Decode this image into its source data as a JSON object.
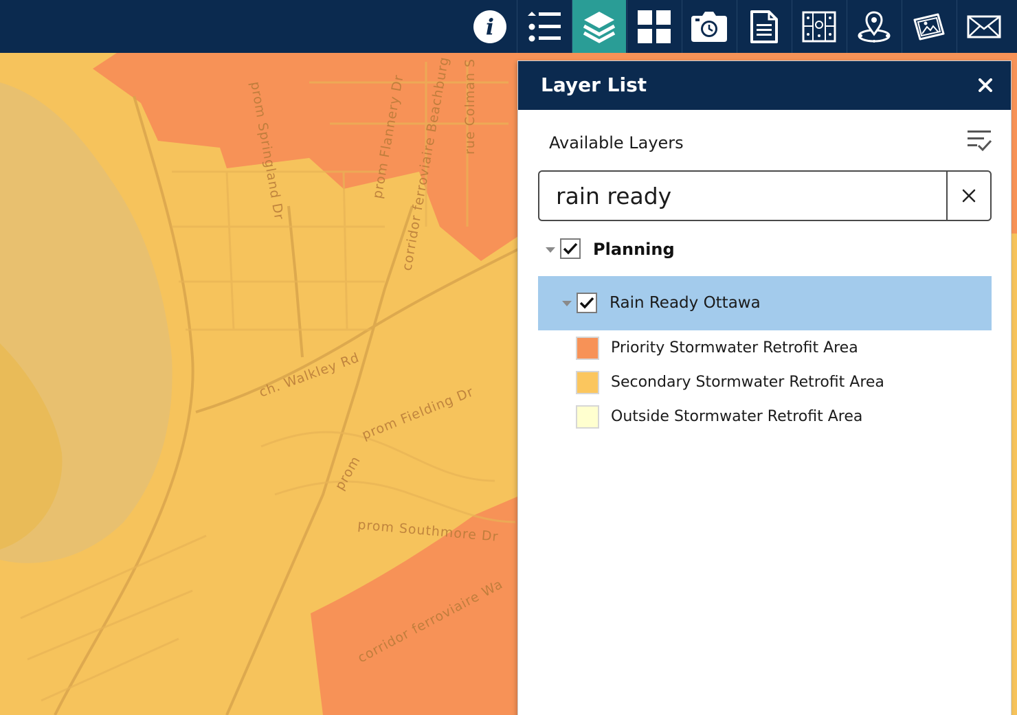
{
  "toolbar": {
    "buttons": [
      {
        "name": "info-icon",
        "active": false
      },
      {
        "name": "legend-list-icon",
        "active": false
      },
      {
        "name": "layers-icon",
        "active": true
      },
      {
        "name": "basemap-grid-icon",
        "active": false
      },
      {
        "name": "timed-camera-icon",
        "active": false
      },
      {
        "name": "document-icon",
        "active": false
      },
      {
        "name": "floor-plan-icon",
        "active": false
      },
      {
        "name": "location-pin-icon",
        "active": false
      },
      {
        "name": "photo-gallery-icon",
        "active": false
      },
      {
        "name": "email-icon",
        "active": false
      }
    ],
    "active_color": "#2a9d96",
    "bar_color": "#0b2a4f"
  },
  "panel": {
    "title": "Layer List",
    "available_label": "Available Layers",
    "search": {
      "value": "rain ready",
      "placeholder": ""
    },
    "group": {
      "label": "Planning",
      "checked": true
    },
    "layer": {
      "label": "Rain Ready Ottawa",
      "checked": true,
      "highlight_color": "#a3cbec"
    },
    "legend": [
      {
        "label": "Priority Stormwater Retrofit Area",
        "color": "#f79257"
      },
      {
        "label": "Secondary Stormwater Retrofit Area",
        "color": "#fbc65e"
      },
      {
        "label": "Outside Stormwater Retrofit Area",
        "color": "#ffffcf"
      }
    ]
  },
  "map": {
    "road_labels": [
      "prom Springland Dr",
      "prom Flannery Dr",
      "corridor ferroviaire Beachburg",
      "rue Colman S",
      "ch. Walkley Rd",
      "prom Fielding Dr",
      "prom Southmore Dr",
      "corridor ferroviaire Wa",
      "prom"
    ],
    "colors": {
      "priority": "#f79257",
      "secondary": "#f6c35c",
      "outside_tint": "#e9c26c"
    }
  }
}
